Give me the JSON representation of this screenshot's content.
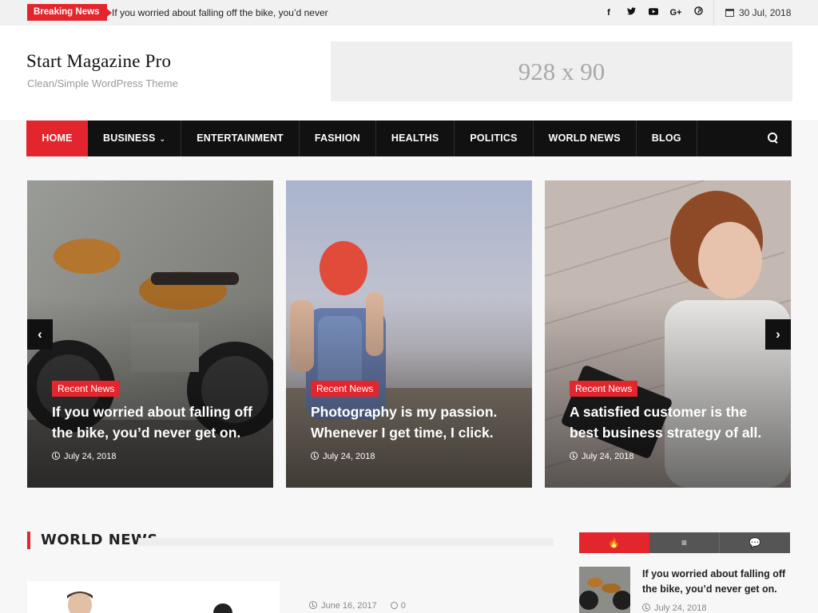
{
  "topbar": {
    "breaking_label": "Breaking News",
    "ticker_text": "If you worried about falling off the bike, you’d never",
    "social": [
      {
        "icon": "facebook-icon",
        "glyph": "f"
      },
      {
        "icon": "twitter-icon",
        "glyph": "🐦"
      },
      {
        "icon": "youtube-icon",
        "glyph": "▶"
      },
      {
        "icon": "google-plus-icon",
        "glyph": "G+"
      },
      {
        "icon": "pinterest-icon",
        "glyph": "℗"
      }
    ],
    "date": "30 Jul, 2018"
  },
  "header": {
    "site_title": "Start Magazine Pro",
    "tagline": "Clean/Simple WordPress Theme",
    "ad_text": "928 x 90"
  },
  "nav": {
    "items": [
      "HOME",
      "BUSINESS",
      "ENTERTAINMENT",
      "FASHION",
      "HEALTHS",
      "POLITICS",
      "WORLD NEWS",
      "BLOG"
    ],
    "dropdown_glyph": "⌄"
  },
  "slider": {
    "prev": "‹",
    "next": "›",
    "slides": [
      {
        "category": "Recent News",
        "title": "If you worried about falling off the bike, you’d never get on.",
        "date": "July 24, 2018"
      },
      {
        "category": "Recent News",
        "title": "Photography is my passion. Whenever I get time, I click.",
        "date": "July 24, 2018"
      },
      {
        "category": "Recent News",
        "title": "A satisfied customer is the best business strategy of all.",
        "date": "July 24, 2018"
      }
    ]
  },
  "world_news": {
    "title": "WORLD NEWS",
    "post": {
      "date": "June 16, 2017",
      "comments": "0"
    }
  },
  "sidebar": {
    "tabs": [
      "🔥",
      "≡",
      "💬"
    ],
    "post": {
      "title": "If you worried about falling off the bike, you’d never get on.",
      "date": "July 24, 2018"
    }
  },
  "colors": {
    "accent": "#e3262d",
    "nav_bg": "#111111",
    "tab_bg": "#555555"
  }
}
